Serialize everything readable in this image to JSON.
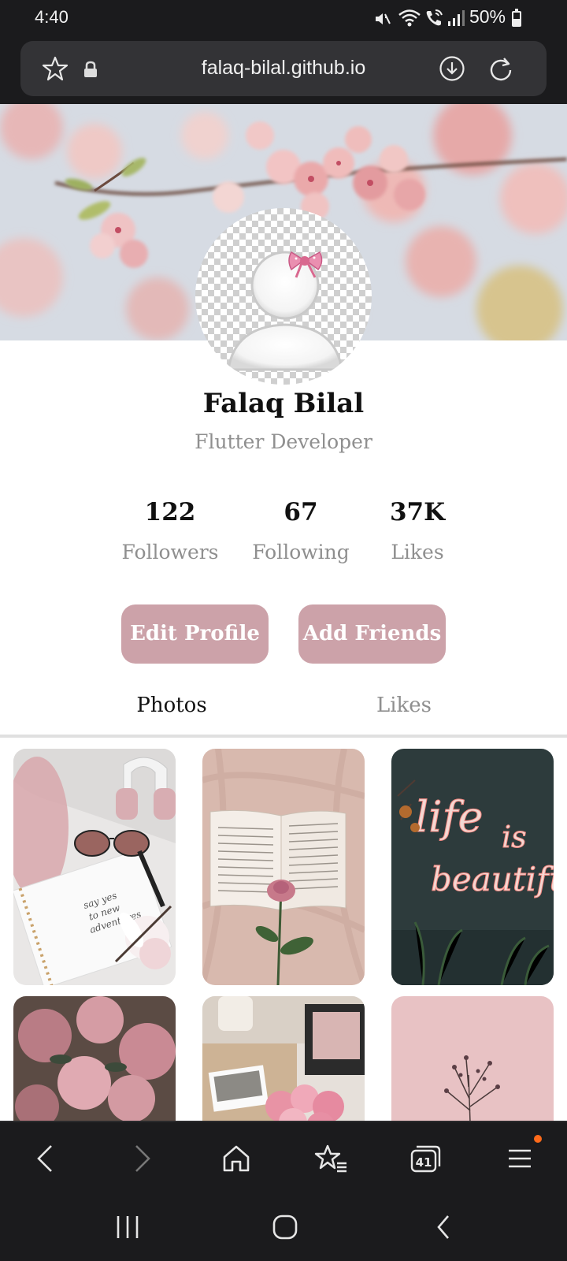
{
  "status_bar": {
    "time": "4:40",
    "icons": [
      "mute-icon",
      "wifi-icon",
      "wifi-calling-icon",
      "signal-icon"
    ],
    "battery_percent": "50%",
    "battery_level": 0.5
  },
  "browser": {
    "url": "falaq-bilal.github.io"
  },
  "profile": {
    "name": "Falaq Bilal",
    "role": "Flutter Developer",
    "stats": [
      {
        "value": "122",
        "label": "Followers"
      },
      {
        "value": "67",
        "label": "Following"
      },
      {
        "value": "37K",
        "label": "Likes"
      }
    ],
    "edit_button": "Edit Profile",
    "add_friends_button": "Add Friends"
  },
  "tabs": [
    {
      "label": "Photos",
      "active": true
    },
    {
      "label": "Likes",
      "active": false
    }
  ],
  "photos": [
    {
      "subject": "notebook-sunglasses-headphones"
    },
    {
      "subject": "open-book-rose"
    },
    {
      "subject": "neon-sign"
    },
    {
      "subject": "pink-flowers"
    },
    {
      "subject": "polaroid-flowers"
    },
    {
      "subject": "dried-flowers-pink-wall"
    }
  ],
  "neon_sign_text": "life is beautiful",
  "bottom_nav": [
    "back-icon",
    "forward-icon",
    "home-icon",
    "bookmarks-icon",
    "tabs-icon",
    "menu-icon"
  ],
  "tabs_count": "41",
  "colors": {
    "accent_button": "#cca2a9",
    "notification_dot": "#ff6a1a",
    "chrome_bg": "#1b1b1d"
  }
}
